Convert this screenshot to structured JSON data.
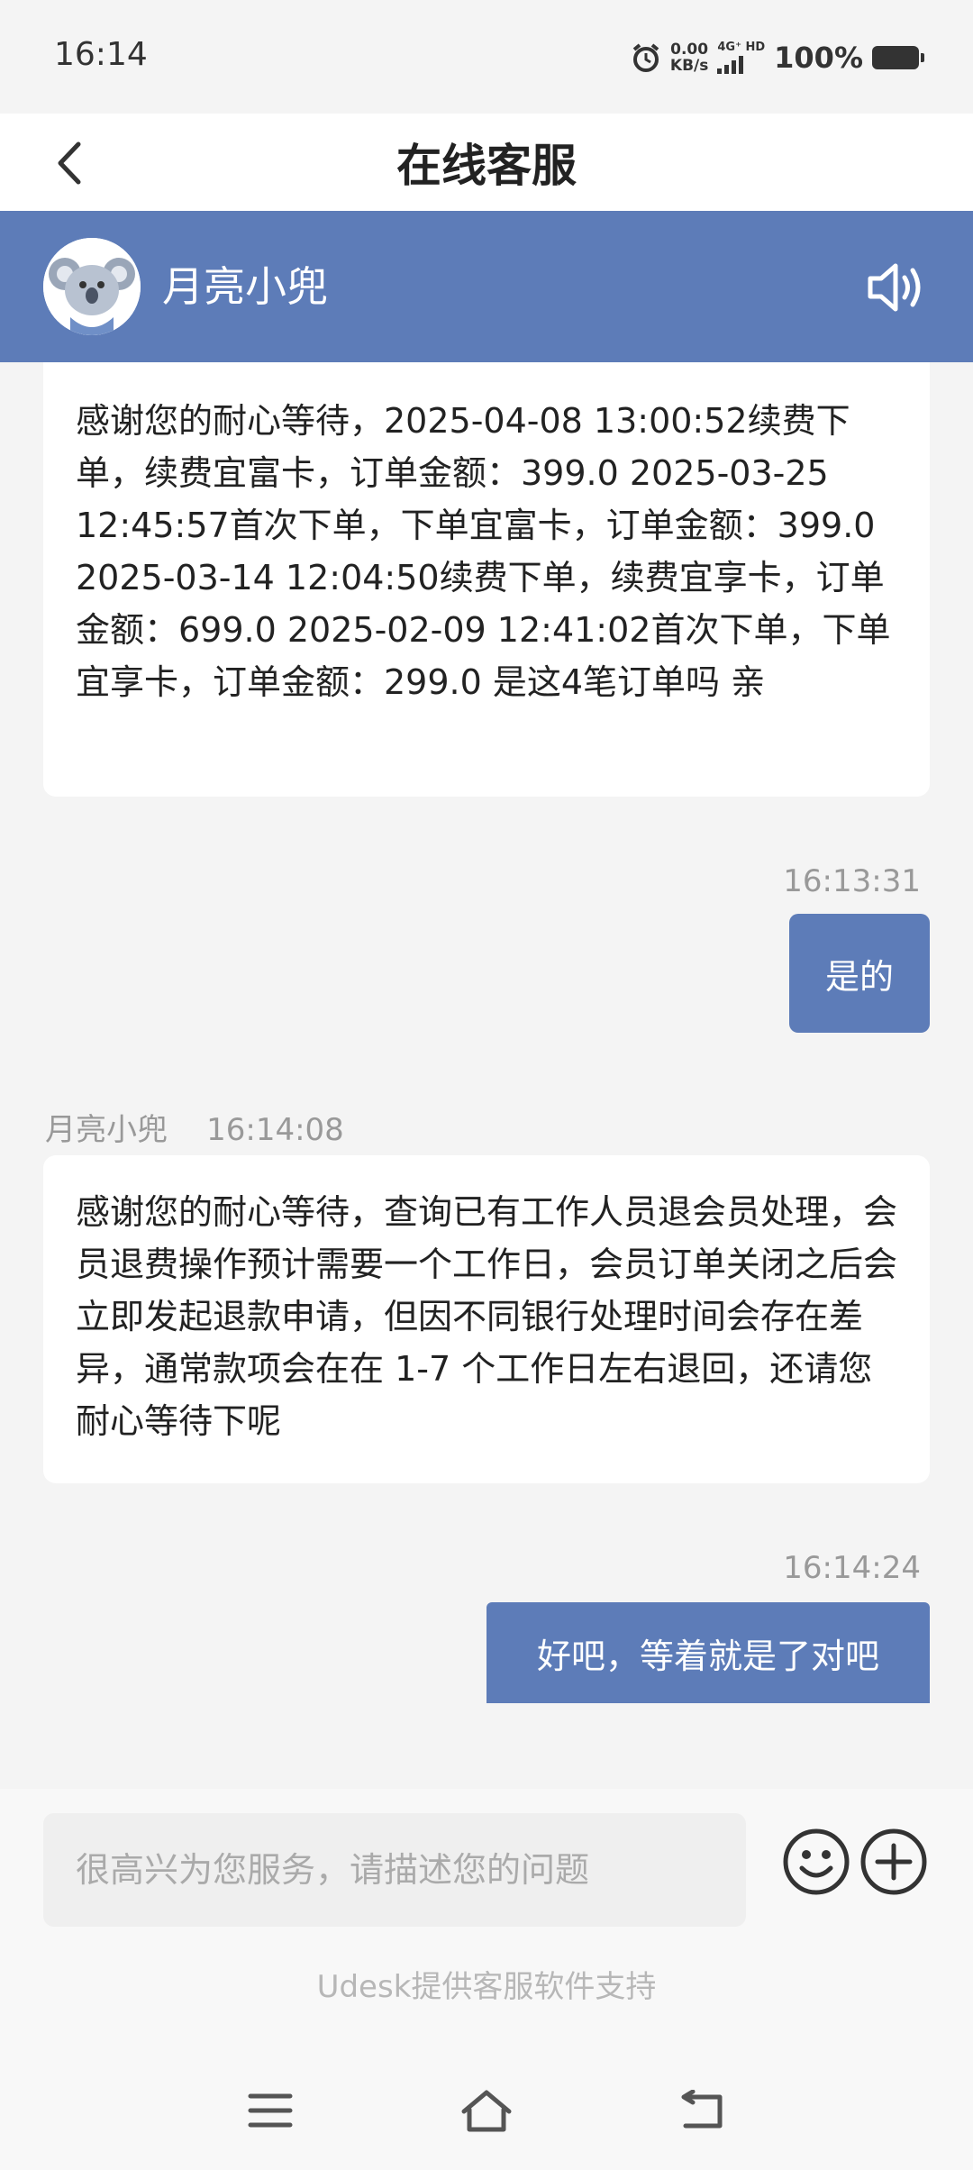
{
  "status_bar": {
    "time": "16:14",
    "net_speed_value": "0.00",
    "net_speed_unit": "KB/s",
    "network_label": "4G⁺ HD",
    "battery": "100%"
  },
  "nav": {
    "title": "在线客服"
  },
  "agent": {
    "name": "月亮小兜"
  },
  "messages": [
    {
      "from": "agent",
      "text": "感谢您的耐心等待，2025-04-08 13:00:52续费下单，续费宜富卡，订单金额：399.0 2025-03-25 12:45:57首次下单，下单宜富卡，订单金额：399.0 2025-03-14 12:04:50续费下单，续费宜享卡，订单金额：699.0 2025-02-09 12:41:02首次下单，下单宜享卡，订单金额：299.0 是这4笔订单吗 亲"
    },
    {
      "from": "user",
      "time": "16:13:31",
      "text": "是的"
    },
    {
      "from": "agent",
      "sender": "月亮小兜",
      "time": "16:14:08",
      "text": "感谢您的耐心等待，查询已有工作人员退会员处理，会员退费操作预计需要一个工作日，会员订单关闭之后会立即发起退款申请，但因不同银行处理时间会存在差异，通常款项会在在 1-7 个工作日左右退回，还请您耐心等待下呢"
    },
    {
      "from": "user",
      "time": "16:14:24",
      "text": "好吧，等着就是了对吧"
    }
  ],
  "input": {
    "placeholder": "很高兴为您服务，请描述您的问题"
  },
  "footer": {
    "powered_by": "Udesk提供客服软件支持"
  },
  "colors": {
    "accent": "#5d7cb8",
    "background": "#f4f4f4"
  },
  "icons": [
    "back-icon",
    "alarm-icon",
    "speaker-icon",
    "emoji-icon",
    "plus-icon",
    "menu-icon",
    "home-icon",
    "back-nav-icon"
  ]
}
